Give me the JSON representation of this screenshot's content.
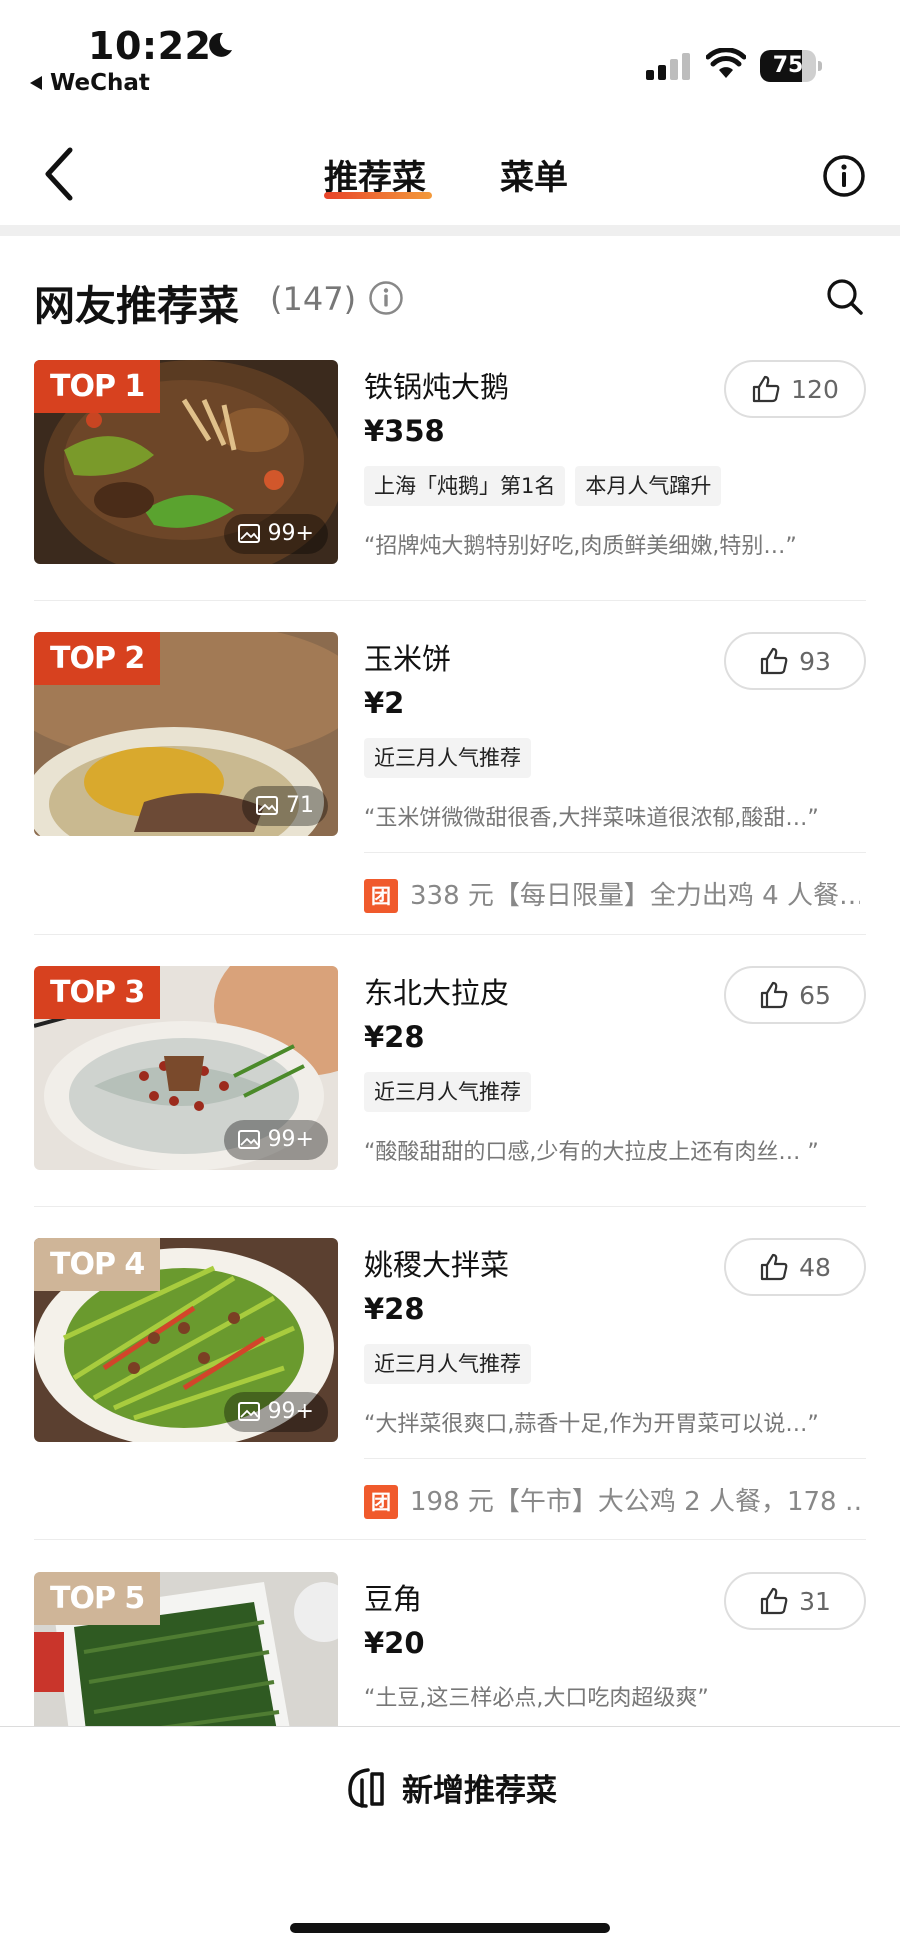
{
  "status": {
    "time": "10:22",
    "back_app": "WeChat",
    "battery": "75",
    "battery_level": 0.75
  },
  "nav": {
    "tabs": [
      "推荐菜",
      "菜单"
    ],
    "active_tab": "推荐菜"
  },
  "section": {
    "title": "网友推荐菜",
    "count": "(147)"
  },
  "items": [
    {
      "rank": "TOP 1",
      "name": "铁锅炖大鹅",
      "price": "¥358",
      "tags": [
        "上海「炖鹅」第1名",
        "本月人气蹿升"
      ],
      "quote": "“招牌炖大鹅特别好吃,肉质鲜美细嫩,特别…”",
      "likes": "120",
      "images": "99+"
    },
    {
      "rank": "TOP 2",
      "name": "玉米饼",
      "price": "¥2",
      "tags": [
        "近三月人气推荐"
      ],
      "quote": "“玉米饼微微甜很香,大拌菜味道很浓郁,酸甜…”",
      "likes": "93",
      "images": "71",
      "deal_icon": "团",
      "deal": "338 元【每日限量】全力出鸡 4 人餐…"
    },
    {
      "rank": "TOP 3",
      "name": "东北大拉皮",
      "price": "¥28",
      "tags": [
        "近三月人气推荐"
      ],
      "quote": "“酸酸甜甜的口感,少有的大拉皮上还有肉丝… ”",
      "likes": "65",
      "images": "99+"
    },
    {
      "rank": "TOP 4",
      "name": "姚稷大拌菜",
      "price": "¥28",
      "tags": [
        "近三月人气推荐"
      ],
      "quote": "“大拌菜很爽口,蒜香十足,作为开胃菜可以说…”",
      "likes": "48",
      "images": "99+",
      "deal_icon": "团",
      "deal": "198 元【午市】大公鸡 2 人餐，178 …"
    },
    {
      "rank": "TOP 5",
      "name": "豆角",
      "price": "¥20",
      "tags": [],
      "quote": "“土豆,这三样必点,大口吃肉超级爽”",
      "likes": "31"
    }
  ],
  "bottom": {
    "add_label": "新增推荐菜"
  },
  "colors": {
    "accent": "#d7411f",
    "accent_gradient_end": "#f39a3b",
    "top_tag_muted": "#cfb598",
    "deal_orange": "#f05a2c"
  }
}
